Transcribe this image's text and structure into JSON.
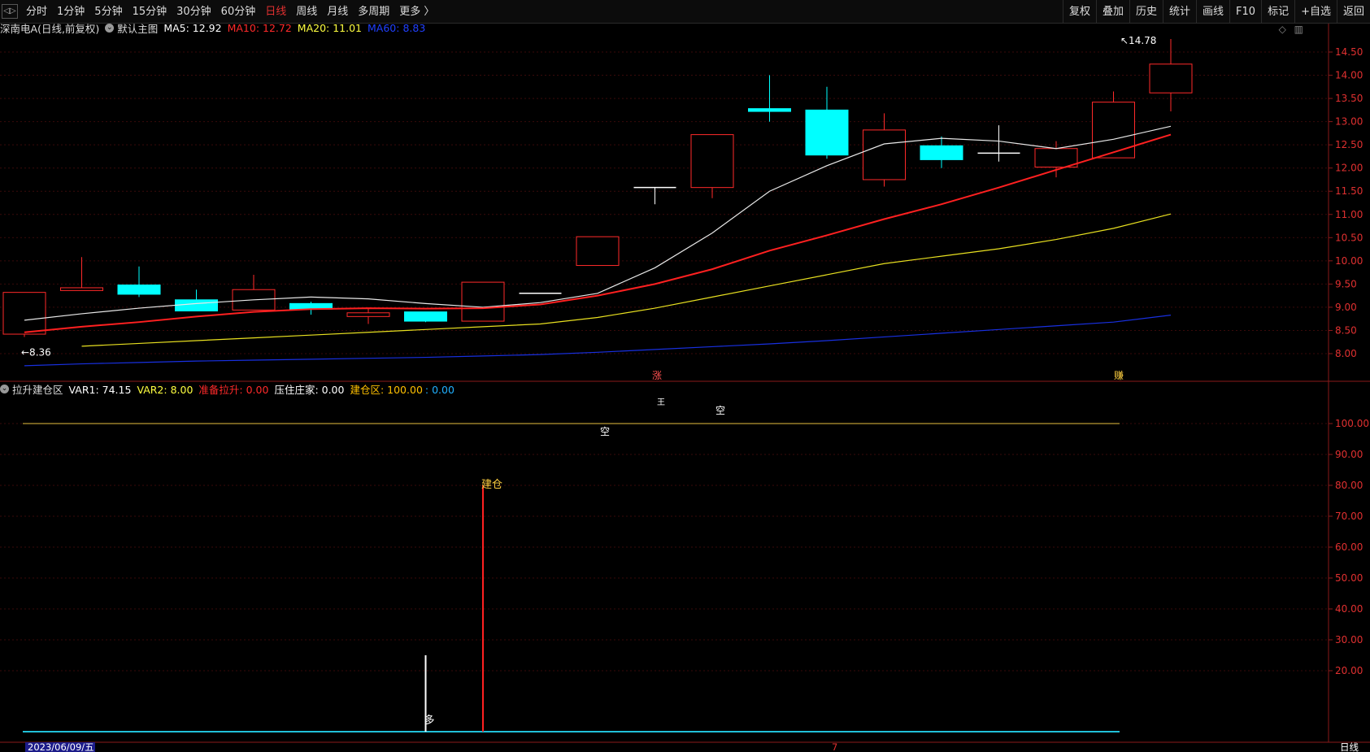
{
  "toolbar": {
    "periods": [
      "分时",
      "1分钟",
      "5分钟",
      "15分钟",
      "30分钟",
      "60分钟",
      "日线",
      "周线",
      "月线",
      "多周期",
      "更多 〉"
    ],
    "active_period": "日线",
    "right_buttons": [
      "复权",
      "叠加",
      "历史",
      "统计",
      "画线",
      "F10",
      "标记",
      "+自选",
      "返回"
    ]
  },
  "main_header": {
    "stock": "深南电A",
    "period_note": "(日线,前复权)",
    "chart_name": "默认主图",
    "ma": [
      {
        "label": "MA5: 12.92",
        "color": "#ffffff"
      },
      {
        "label": "MA10: 12.72",
        "color": "#ff2a2a"
      },
      {
        "label": "MA20: 11.01",
        "color": "#ffff40"
      },
      {
        "label": "MA60: 8.83",
        "color": "#2040ff"
      }
    ]
  },
  "sub_header": {
    "name": "拉升建仓区",
    "vars": [
      {
        "label": "VAR1: 74.15",
        "color": "#ffffff"
      },
      {
        "label": "VAR2: 8.00",
        "color": "#ffff40"
      },
      {
        "label": "准备拉升: 0.00",
        "color": "#ff2a2a"
      },
      {
        "label": "压住庄家: 0.00",
        "color": "#ffffff"
      },
      {
        "label": "建仓区: 100.00",
        "color": "#ffc000"
      },
      {
        "label": ": 0.00",
        "color": "#20b0ff"
      }
    ]
  },
  "chart_data": [
    {
      "type": "candlestick",
      "title": "深南电A(日线,前复权)",
      "ylim": [
        7.5,
        14.9
      ],
      "yticks": [
        "14.50",
        "14.00",
        "13.50",
        "13.00",
        "12.50",
        "12.00",
        "11.50",
        "11.00",
        "10.50",
        "10.00",
        "9.50",
        "9.00",
        "8.50",
        "8.00"
      ],
      "candles": [
        {
          "o": 8.42,
          "h": 9.32,
          "l": 8.36,
          "c": 9.32
        },
        {
          "o": 9.36,
          "h": 10.08,
          "l": 9.36,
          "c": 9.42
        },
        {
          "o": 9.48,
          "h": 9.88,
          "l": 9.22,
          "c": 9.28
        },
        {
          "o": 9.16,
          "h": 9.38,
          "l": 8.92,
          "c": 8.92
        },
        {
          "o": 8.94,
          "h": 9.7,
          "l": 8.94,
          "c": 9.38
        },
        {
          "o": 9.08,
          "h": 9.12,
          "l": 8.84,
          "c": 8.96
        },
        {
          "o": 8.8,
          "h": 8.98,
          "l": 8.64,
          "c": 8.88
        },
        {
          "o": 8.9,
          "h": 8.9,
          "l": 8.68,
          "c": 8.7
        },
        {
          "o": 8.7,
          "h": 9.54,
          "l": 8.7,
          "c": 9.54
        },
        {
          "o": 9.3,
          "h": 9.3,
          "l": 9.3,
          "c": 9.3
        },
        {
          "o": 9.9,
          "h": 10.52,
          "l": 9.9,
          "c": 10.52
        },
        {
          "o": 11.58,
          "h": 11.58,
          "l": 11.22,
          "c": 11.58
        },
        {
          "o": 11.58,
          "h": 12.72,
          "l": 11.35,
          "c": 12.72
        },
        {
          "o": 13.28,
          "h": 14.0,
          "l": 13.0,
          "c": 13.22
        },
        {
          "o": 13.25,
          "h": 13.75,
          "l": 12.2,
          "c": 12.28
        },
        {
          "o": 11.75,
          "h": 13.18,
          "l": 11.6,
          "c": 12.82
        },
        {
          "o": 12.48,
          "h": 12.68,
          "l": 12.0,
          "c": 12.18
        },
        {
          "o": 12.32,
          "h": 12.92,
          "l": 12.14,
          "c": 12.32
        },
        {
          "o": 12.02,
          "h": 12.58,
          "l": 11.8,
          "c": 12.42
        },
        {
          "o": 12.22,
          "h": 13.65,
          "l": 12.22,
          "c": 13.42
        },
        {
          "o": 13.62,
          "h": 14.78,
          "l": 13.22,
          "c": 14.24
        }
      ],
      "series": [
        {
          "name": "MA5",
          "color": "#e8e8e8",
          "values": [
            8.72,
            8.86,
            8.98,
            9.08,
            9.16,
            9.22,
            9.18,
            9.08,
            9.0,
            9.1,
            9.3,
            9.85,
            10.6,
            11.5,
            12.05,
            12.52,
            12.64,
            12.58,
            12.42,
            12.62,
            12.9
          ]
        },
        {
          "name": "MA10",
          "color": "#ff2020",
          "values": [
            8.46,
            8.58,
            8.68,
            8.8,
            8.9,
            8.96,
            8.98,
            8.97,
            8.98,
            9.06,
            9.25,
            9.5,
            9.82,
            10.22,
            10.55,
            10.9,
            11.22,
            11.58,
            11.96,
            12.34,
            12.72
          ]
        },
        {
          "name": "MA20",
          "color": "#e8e020",
          "values": [
            8.16,
            8.22,
            8.28,
            8.34,
            8.4,
            8.46,
            8.52,
            8.58,
            8.64,
            8.78,
            8.98,
            9.22,
            9.46,
            9.7,
            9.94,
            10.1,
            10.26,
            10.46,
            10.7,
            11.01
          ]
        },
        {
          "name": "MA60",
          "color": "#1830e0",
          "values": [
            7.74,
            7.78,
            7.81,
            7.84,
            7.86,
            7.88,
            7.9,
            7.92,
            7.95,
            7.98,
            8.03,
            8.09,
            8.15,
            8.21,
            8.28,
            8.36,
            8.44,
            8.52,
            8.6,
            8.68,
            8.83
          ]
        }
      ],
      "annotations": {
        "low_label": "8.36",
        "high_label": "14.78",
        "signals": [
          "涨",
          "赚"
        ]
      }
    },
    {
      "type": "bar",
      "title": "拉升建仓区",
      "ylim": [
        0,
        110
      ],
      "yticks": [
        "100.00",
        "90.00",
        "80.00",
        "70.00",
        "60.00",
        "50.00",
        "40.00",
        "30.00",
        "20.00"
      ],
      "level_line": 100,
      "bars": [
        {
          "index": 7,
          "value": 25,
          "color": "#ffffff",
          "label": "多"
        },
        {
          "index": 8,
          "value": 80,
          "color": "#ff2020",
          "label": "建仓"
        }
      ],
      "text_marks": [
        "空",
        "空",
        "王"
      ],
      "baseline_color": "#20c0d8"
    }
  ],
  "footer": {
    "date_label": "2023/06/09/五",
    "month_mark": "7",
    "period_label": "日线"
  }
}
